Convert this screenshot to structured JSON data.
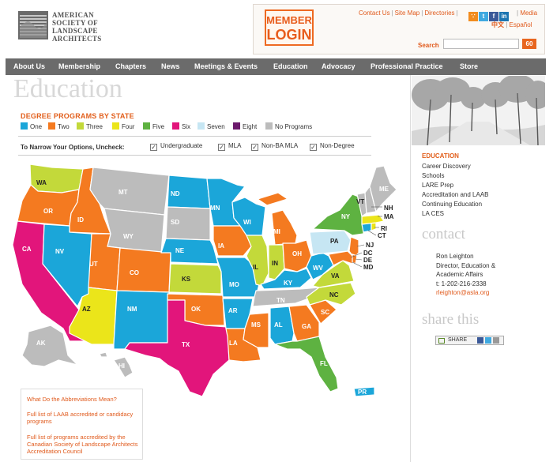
{
  "header": {
    "logo_lines": [
      "AMERICAN",
      "SOCIETY OF",
      "LANDSCAPE",
      "ARCHITECTS"
    ],
    "member_login": [
      "MEMBER",
      "LOGIN"
    ],
    "util_links": [
      "Contact Us",
      "Site Map",
      "Directories"
    ],
    "media_link": "Media",
    "lang_links": [
      "中文",
      "Español"
    ],
    "search_label": "Search",
    "search_value": "",
    "search_button": "60",
    "social_icons": [
      "rss-icon",
      "twitter-icon",
      "facebook-icon",
      "linkedin-icon"
    ]
  },
  "nav": [
    "About Us",
    "Membership",
    "Chapters",
    "News",
    "Meetings & Events",
    "Education",
    "Advocacy",
    "Professional Practice",
    "Store"
  ],
  "page_title": "Education",
  "degree_heading": "DEGREE PROGRAMS BY STATE",
  "legend": [
    {
      "label": "One",
      "color": "#1ba6d9"
    },
    {
      "label": "Two",
      "color": "#f47a20"
    },
    {
      "label": "Three",
      "color": "#c3d93a"
    },
    {
      "label": "Four",
      "color": "#ebe51a"
    },
    {
      "label": "Five",
      "color": "#5eb241"
    },
    {
      "label": "Six",
      "color": "#e2157b"
    },
    {
      "label": "Seven",
      "color": "#c6e6f3"
    },
    {
      "label": "Eight",
      "color": "#6d1a6d"
    },
    {
      "label": "No Programs",
      "color": "#bcbcbc"
    }
  ],
  "filter": {
    "label": "To Narrow Your Options, Uncheck:",
    "options": [
      {
        "label": "Undergraduate",
        "checked": true
      },
      {
        "label": "MLA",
        "checked": true
      },
      {
        "label": "Non-BA MLA",
        "checked": true
      },
      {
        "label": "Non-Degree",
        "checked": true
      }
    ]
  },
  "map_states": [
    "WA",
    "OR",
    "CA",
    "ID",
    "NV",
    "MT",
    "WY",
    "UT",
    "AZ",
    "CO",
    "NM",
    "ND",
    "SD",
    "NE",
    "KS",
    "OK",
    "TX",
    "MN",
    "IA",
    "MO",
    "AR",
    "LA",
    "WI",
    "IL",
    "MS",
    "MI",
    "IN",
    "OH",
    "KY",
    "TN",
    "AL",
    "GA",
    "FL",
    "SC",
    "NC",
    "VA",
    "WV",
    "PA",
    "NY",
    "VT",
    "NH",
    "ME",
    "MA",
    "RI",
    "CT",
    "NJ",
    "DE",
    "MD",
    "DC",
    "AK",
    "HI",
    "PR"
  ],
  "links_box": [
    "What Do the Abbreviations Mean?",
    "Full list of LAAB accredited or candidacy programs",
    "Full list of programs accredited by the Canadian Society of Landscape Architects Accreditation Council"
  ],
  "sidebar": {
    "section_title": "EDUCATION",
    "items": [
      "Career Discovery",
      "Schools",
      "LARE Prep",
      "Accreditation and LAAB",
      "Continuing Education",
      "LA CES"
    ],
    "contact_heading": "contact",
    "contact": {
      "name": "Ron Leighton",
      "title_lines": [
        "Director, Education &",
        "Academic Affairs"
      ],
      "phone": "t: 1-202-216-2338",
      "email": "rleighton@asla.org"
    },
    "share_heading": "share this",
    "share_button": "SHARE"
  }
}
